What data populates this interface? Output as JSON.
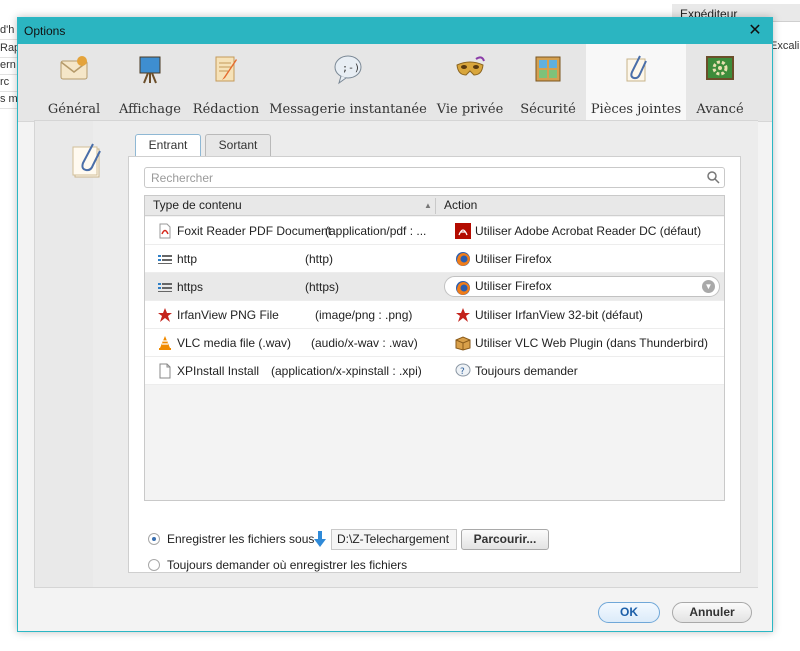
{
  "background": {
    "header_col": "Expéditeur",
    "left_rows": [
      "d'h",
      "Rap",
      "ern",
      "rc",
      "s m"
    ],
    "right_cell": "Excali"
  },
  "dialog": {
    "title": "Options",
    "close_label": "✕"
  },
  "toolbar": {
    "items": [
      {
        "label": "Général",
        "icon": "envelope-icon"
      },
      {
        "label": "Affichage",
        "icon": "easel-icon"
      },
      {
        "label": "Rédaction",
        "icon": "notepad-icon"
      },
      {
        "label": "Messagerie instantanée",
        "icon": "chat-bubble-icon"
      },
      {
        "label": "Vie privée",
        "icon": "mask-icon"
      },
      {
        "label": "Sécurité",
        "icon": "window-icon"
      },
      {
        "label": "Pièces jointes",
        "icon": "paperclip-icon"
      },
      {
        "label": "Avancé",
        "icon": "gear-board-icon"
      }
    ],
    "active_index": 6
  },
  "tabs": {
    "incoming": "Entrant",
    "outgoing": "Sortant"
  },
  "search": {
    "placeholder": "Rechercher"
  },
  "table": {
    "columns": [
      "Type de contenu",
      "Action"
    ],
    "rows": [
      {
        "type": "Foxit Reader PDF Document",
        "mime": "(application/pdf : ...",
        "action": "Utiliser Adobe Acrobat Reader DC  (défaut)",
        "type_icon": "pdf-file-icon",
        "action_icon": "acrobat-icon"
      },
      {
        "type": "http",
        "mime": "(http)",
        "action": "Utiliser Firefox",
        "type_icon": "protocol-icon",
        "action_icon": "firefox-icon"
      },
      {
        "type": "https",
        "mime": "(https)",
        "action": "Utiliser Firefox",
        "type_icon": "protocol-icon",
        "action_icon": "firefox-icon"
      },
      {
        "type": "IrfanView PNG File",
        "mime": "(image/png : .png)",
        "action": "Utiliser IrfanView 32-bit (défaut)",
        "type_icon": "irfanview-icon",
        "action_icon": "irfanview-icon"
      },
      {
        "type": "VLC media file (.wav)",
        "mime": "(audio/x-wav : .wav)",
        "action": "Utiliser VLC Web Plugin (dans Thunderbird)",
        "type_icon": "vlc-cone-icon",
        "action_icon": "plugin-box-icon"
      },
      {
        "type": "XPInstall Install",
        "mime": "(application/x-xpinstall : .xpi)",
        "action": "Toujours demander",
        "type_icon": "blank-file-icon",
        "action_icon": "question-icon"
      }
    ],
    "selected_index": 2
  },
  "save": {
    "option_save_to": "Enregistrer les fichiers sous",
    "path": "D:\\Z-Telechargement",
    "browse": "Parcourir...",
    "option_always_ask": "Toujours demander où enregistrer les fichiers",
    "selected": "save_to"
  },
  "buttons": {
    "ok": "OK",
    "cancel": "Annuler"
  }
}
